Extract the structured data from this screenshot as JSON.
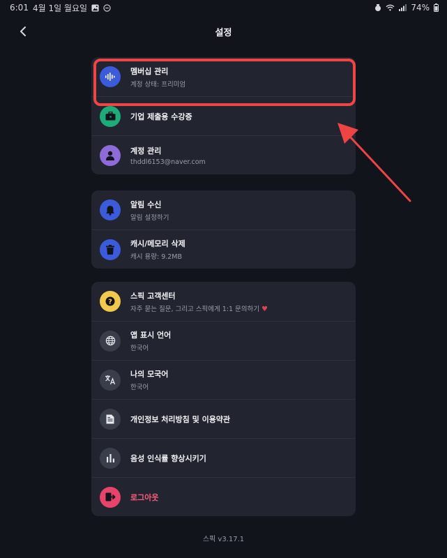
{
  "status_bar": {
    "time": "6:01",
    "date": "4월 1일 월요일",
    "battery": "74%"
  },
  "nav": {
    "title": "설정"
  },
  "groups": [
    {
      "items": [
        {
          "title": "멤버십 관리",
          "subtitle": "계정 상태: 프리미엄",
          "icon": "waveform-icon",
          "color": "#3b5bdb"
        },
        {
          "title": "기업 제출용 수강증",
          "subtitle": "",
          "icon": "briefcase-icon",
          "color": "#1faa7a"
        },
        {
          "title": "계정 관리",
          "subtitle": "thddl6153@naver.com",
          "icon": "person-icon",
          "color": "#8e6bd8"
        }
      ]
    },
    {
      "items": [
        {
          "title": "알림 수신",
          "subtitle": "알림 설정하기",
          "icon": "bell-icon",
          "color": "#3b5bdb"
        },
        {
          "title": "캐시/메모리 삭제",
          "subtitle": "캐시 용량: 9.2MB",
          "icon": "trash-icon",
          "color": "#3b5bdb"
        }
      ]
    },
    {
      "items": [
        {
          "title": "스픽 고객센터",
          "subtitle": "자주 묻는 질문, 그리고 스픽에게 1:1 문의하기",
          "icon": "question-icon",
          "color": "#f2c94c"
        },
        {
          "title": "앱 표시 언어",
          "subtitle": "한국어",
          "icon": "globe-icon",
          "color": "#3a3e4a"
        },
        {
          "title": "나의 모국어",
          "subtitle": "한국어",
          "icon": "translate-icon",
          "color": "#3a3e4a"
        },
        {
          "title": "개인정보 처리방침 및 이용약관",
          "subtitle": "",
          "icon": "document-icon",
          "color": "#3a3e4a"
        },
        {
          "title": "음성 인식률 향상시키기",
          "subtitle": "",
          "icon": "bar-chart-icon",
          "color": "#3a3e4a"
        },
        {
          "title": "로그아웃",
          "subtitle": "",
          "icon": "logout-icon",
          "color": "#e8436b",
          "title_color": "#ff5d7e"
        }
      ]
    }
  ],
  "version": "스픽 v3.17.1",
  "colors": {
    "background": "#12141b",
    "card": "#222530",
    "highlight": "#f04545"
  }
}
